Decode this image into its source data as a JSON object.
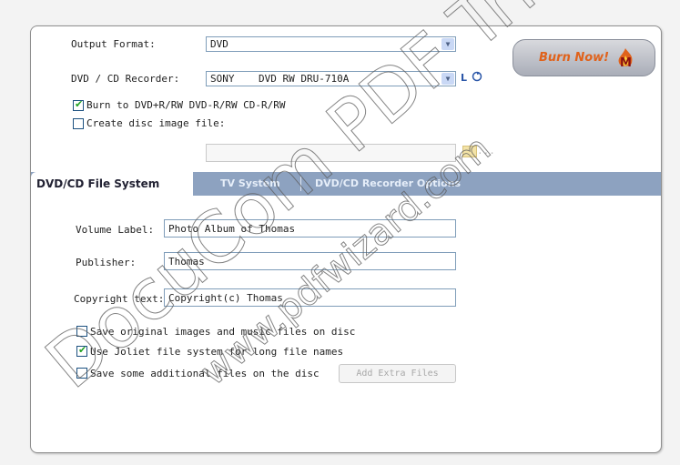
{
  "form": {
    "output_format_label": "Output Format:",
    "output_format_value": "DVD",
    "recorder_label": "DVD / CD Recorder:",
    "recorder_value": "SONY    DVD RW DRU-710A",
    "recorder_suffix_l": "L",
    "recorder_suffix_icon": "refresh-icon",
    "burn_to_label": "Burn to DVD+R/RW DVD-R/RW  CD-R/RW",
    "burn_to_checked": true,
    "create_image_label": "Create disc image file:",
    "create_image_checked": false,
    "image_path_value": "",
    "browse_label": "..."
  },
  "burn_button": {
    "label": "Burn Now!",
    "icon": "flame-icon"
  },
  "tabs": [
    {
      "label": "DVD/CD File System",
      "active": true
    },
    {
      "label": "TV System",
      "active": false
    },
    {
      "label": "DVD/CD Recorder Options",
      "active": false
    }
  ],
  "filesystem": {
    "volume_label_label": "Volume Label:",
    "volume_label_value": "Photo Album of Thomas",
    "publisher_label": "Publisher:",
    "publisher_value": "Thomas",
    "copyright_label": "Copyright text:",
    "copyright_value": "Copyright(c) Thomas",
    "opt_save_originals": "Save original images and music files on disc",
    "opt_save_originals_checked": false,
    "opt_joliet": "Use Joliet file system for long file names",
    "opt_joliet_checked": true,
    "opt_additional": "Save some additional files on the disc",
    "opt_additional_checked": false,
    "add_extra_files_label": "Add Extra Files"
  },
  "watermark": {
    "line1": "DocuCom PDF Trial",
    "line2": "www.pdfwizard.com"
  },
  "colors": {
    "tab_bar": "#8da2c0",
    "burn_text": "#e0621b",
    "check_mark": "#21a121"
  }
}
